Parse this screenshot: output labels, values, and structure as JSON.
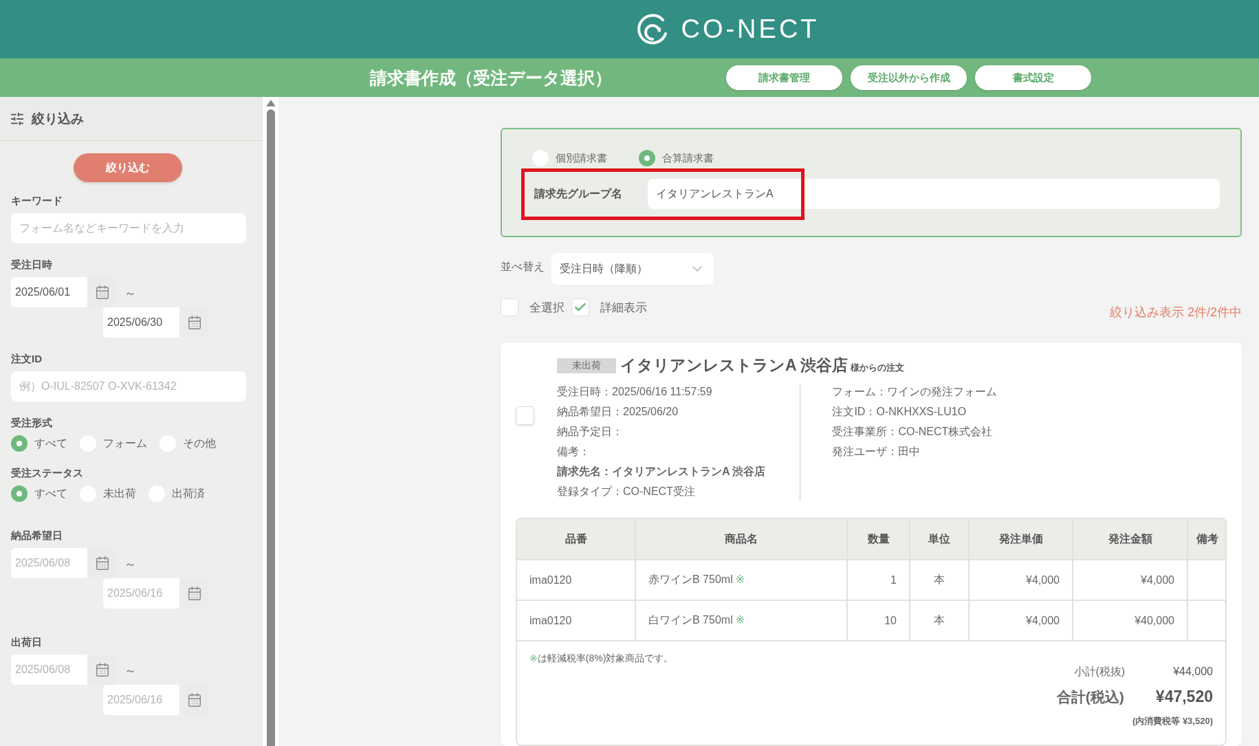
{
  "header": {
    "logo": "CO-NECT"
  },
  "title_bar": {
    "title": "請求書作成（受注データ選択）",
    "buttons": [
      "請求書管理",
      "受注以外から作成",
      "書式設定"
    ]
  },
  "sidebar": {
    "title": "絞り込み",
    "apply_button": "絞り込む",
    "fields": [
      {
        "kind": "text",
        "label": "キーワード",
        "placeholder": "フォーム名などキーワードを入力"
      },
      {
        "kind": "daterange",
        "label": "受注日時",
        "from": {
          "value": "2025/06/01"
        },
        "separator": "～",
        "to": {
          "value": "2025/06/30"
        }
      },
      {
        "kind": "text",
        "label": "注文ID",
        "placeholder": "例）O-IUL-82507 O-XVK-61342"
      },
      {
        "kind": "radio",
        "label": "受注形式",
        "options": [
          {
            "label": "すべて",
            "selected": true
          },
          {
            "label": "フォーム",
            "selected": false
          },
          {
            "label": "その他",
            "selected": false
          }
        ]
      },
      {
        "kind": "radio",
        "label": "受注ステータス",
        "options": [
          {
            "label": "すべて",
            "selected": true
          },
          {
            "label": "未出荷",
            "selected": false
          },
          {
            "label": "出荷済",
            "selected": false
          }
        ]
      },
      {
        "kind": "daterange",
        "label": "納品希望日",
        "from": {
          "placeholder": "2025/06/08"
        },
        "separator": "～",
        "to": {
          "placeholder": "2025/06/16"
        }
      },
      {
        "kind": "daterange",
        "label": "出荷日",
        "from": {
          "placeholder": "2025/06/08"
        },
        "separator": "～",
        "to": {
          "placeholder": "2025/06/16"
        }
      }
    ]
  },
  "invoice_type": {
    "options": [
      {
        "label": "個別請求書",
        "selected": false
      },
      {
        "label": "合算請求書",
        "selected": true
      }
    ],
    "group_name": {
      "label": "請求先グループ名",
      "value": "イタリアンレストランA",
      "highlighted": true
    }
  },
  "sort": {
    "label": "並べ替え",
    "value": "受注日時（降順）"
  },
  "toggles": [
    {
      "label": "全選択",
      "checked": false
    },
    {
      "label": "詳細表示",
      "checked": true
    }
  ],
  "result_count": "絞り込み表示 2件/2件中",
  "orders": [
    {
      "checked": false,
      "status": "未出荷",
      "customer": "イタリアンレストランA 渋谷店",
      "suffix": "様からの注文",
      "details_left": [
        {
          "text": "受注日時：2025/06/16 11:57:59",
          "bold": false
        },
        {
          "text": "納品希望日：2025/06/20",
          "bold": false
        },
        {
          "text": "納品予定日：",
          "bold": false
        },
        {
          "text": "備考：",
          "bold": false
        },
        {
          "text": "請求先名：イタリアンレストランA 渋谷店",
          "bold": true
        },
        {
          "text": "登録タイプ：CO-NECT受注",
          "bold": false
        }
      ],
      "details_right": [
        {
          "text": "フォーム：ワインの発注フォーム",
          "bold": false
        },
        {
          "text": "注文ID：O-NKHXXS-LU1O",
          "bold": false
        },
        {
          "text": "受注事業所：CO-NECT株式会社",
          "bold": false
        },
        {
          "text": "発注ユーザ：田中",
          "bold": false
        }
      ],
      "table": {
        "columns": [
          "品番",
          "商品名",
          "数量",
          "単位",
          "発注単価",
          "発注金額",
          "備考"
        ],
        "rows": [
          {
            "code": "ima0120",
            "name": "赤ワインB 750ml",
            "mark": "※",
            "qty": "1",
            "unit": "本",
            "price": "¥4,000",
            "amount": "¥4,000"
          },
          {
            "code": "ima0120",
            "name": "白ワインB 750ml",
            "mark": "※",
            "qty": "10",
            "unit": "本",
            "price": "¥4,000",
            "amount": "¥40,000"
          }
        ]
      },
      "note": {
        "mark": "※",
        "text": "は軽減税率(8%)対象商品です。"
      },
      "subtotal": {
        "label": "小計(税抜)",
        "value": "¥44,000"
      },
      "total": {
        "label": "合計(税込)",
        "value": "¥47,520"
      },
      "tax_note": "(内消費税等 ¥3,520)"
    }
  ]
}
